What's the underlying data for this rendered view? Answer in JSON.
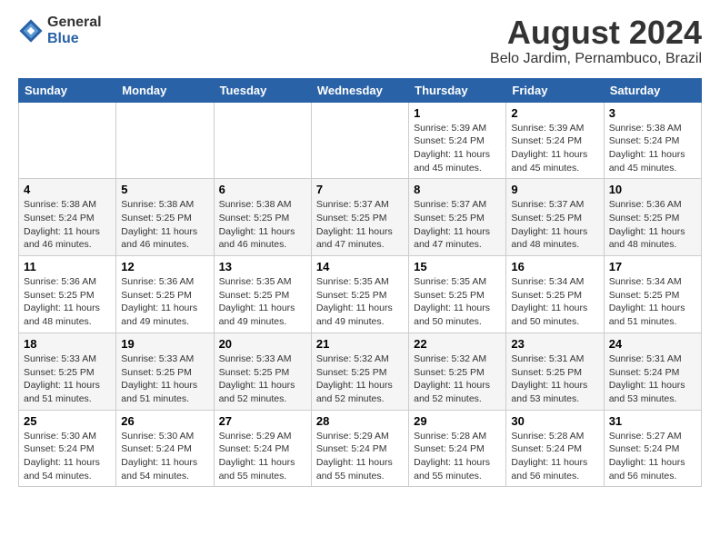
{
  "logo": {
    "line1": "General",
    "line2": "Blue"
  },
  "title": "August 2024",
  "subtitle": "Belo Jardim, Pernambuco, Brazil",
  "days_of_week": [
    "Sunday",
    "Monday",
    "Tuesday",
    "Wednesday",
    "Thursday",
    "Friday",
    "Saturday"
  ],
  "weeks": [
    [
      {
        "day": "",
        "info": ""
      },
      {
        "day": "",
        "info": ""
      },
      {
        "day": "",
        "info": ""
      },
      {
        "day": "",
        "info": ""
      },
      {
        "day": "1",
        "info": "Sunrise: 5:39 AM\nSunset: 5:24 PM\nDaylight: 11 hours\nand 45 minutes."
      },
      {
        "day": "2",
        "info": "Sunrise: 5:39 AM\nSunset: 5:24 PM\nDaylight: 11 hours\nand 45 minutes."
      },
      {
        "day": "3",
        "info": "Sunrise: 5:38 AM\nSunset: 5:24 PM\nDaylight: 11 hours\nand 45 minutes."
      }
    ],
    [
      {
        "day": "4",
        "info": "Sunrise: 5:38 AM\nSunset: 5:24 PM\nDaylight: 11 hours\nand 46 minutes."
      },
      {
        "day": "5",
        "info": "Sunrise: 5:38 AM\nSunset: 5:25 PM\nDaylight: 11 hours\nand 46 minutes."
      },
      {
        "day": "6",
        "info": "Sunrise: 5:38 AM\nSunset: 5:25 PM\nDaylight: 11 hours\nand 46 minutes."
      },
      {
        "day": "7",
        "info": "Sunrise: 5:37 AM\nSunset: 5:25 PM\nDaylight: 11 hours\nand 47 minutes."
      },
      {
        "day": "8",
        "info": "Sunrise: 5:37 AM\nSunset: 5:25 PM\nDaylight: 11 hours\nand 47 minutes."
      },
      {
        "day": "9",
        "info": "Sunrise: 5:37 AM\nSunset: 5:25 PM\nDaylight: 11 hours\nand 48 minutes."
      },
      {
        "day": "10",
        "info": "Sunrise: 5:36 AM\nSunset: 5:25 PM\nDaylight: 11 hours\nand 48 minutes."
      }
    ],
    [
      {
        "day": "11",
        "info": "Sunrise: 5:36 AM\nSunset: 5:25 PM\nDaylight: 11 hours\nand 48 minutes."
      },
      {
        "day": "12",
        "info": "Sunrise: 5:36 AM\nSunset: 5:25 PM\nDaylight: 11 hours\nand 49 minutes."
      },
      {
        "day": "13",
        "info": "Sunrise: 5:35 AM\nSunset: 5:25 PM\nDaylight: 11 hours\nand 49 minutes."
      },
      {
        "day": "14",
        "info": "Sunrise: 5:35 AM\nSunset: 5:25 PM\nDaylight: 11 hours\nand 49 minutes."
      },
      {
        "day": "15",
        "info": "Sunrise: 5:35 AM\nSunset: 5:25 PM\nDaylight: 11 hours\nand 50 minutes."
      },
      {
        "day": "16",
        "info": "Sunrise: 5:34 AM\nSunset: 5:25 PM\nDaylight: 11 hours\nand 50 minutes."
      },
      {
        "day": "17",
        "info": "Sunrise: 5:34 AM\nSunset: 5:25 PM\nDaylight: 11 hours\nand 51 minutes."
      }
    ],
    [
      {
        "day": "18",
        "info": "Sunrise: 5:33 AM\nSunset: 5:25 PM\nDaylight: 11 hours\nand 51 minutes."
      },
      {
        "day": "19",
        "info": "Sunrise: 5:33 AM\nSunset: 5:25 PM\nDaylight: 11 hours\nand 51 minutes."
      },
      {
        "day": "20",
        "info": "Sunrise: 5:33 AM\nSunset: 5:25 PM\nDaylight: 11 hours\nand 52 minutes."
      },
      {
        "day": "21",
        "info": "Sunrise: 5:32 AM\nSunset: 5:25 PM\nDaylight: 11 hours\nand 52 minutes."
      },
      {
        "day": "22",
        "info": "Sunrise: 5:32 AM\nSunset: 5:25 PM\nDaylight: 11 hours\nand 52 minutes."
      },
      {
        "day": "23",
        "info": "Sunrise: 5:31 AM\nSunset: 5:25 PM\nDaylight: 11 hours\nand 53 minutes."
      },
      {
        "day": "24",
        "info": "Sunrise: 5:31 AM\nSunset: 5:24 PM\nDaylight: 11 hours\nand 53 minutes."
      }
    ],
    [
      {
        "day": "25",
        "info": "Sunrise: 5:30 AM\nSunset: 5:24 PM\nDaylight: 11 hours\nand 54 minutes."
      },
      {
        "day": "26",
        "info": "Sunrise: 5:30 AM\nSunset: 5:24 PM\nDaylight: 11 hours\nand 54 minutes."
      },
      {
        "day": "27",
        "info": "Sunrise: 5:29 AM\nSunset: 5:24 PM\nDaylight: 11 hours\nand 55 minutes."
      },
      {
        "day": "28",
        "info": "Sunrise: 5:29 AM\nSunset: 5:24 PM\nDaylight: 11 hours\nand 55 minutes."
      },
      {
        "day": "29",
        "info": "Sunrise: 5:28 AM\nSunset: 5:24 PM\nDaylight: 11 hours\nand 55 minutes."
      },
      {
        "day": "30",
        "info": "Sunrise: 5:28 AM\nSunset: 5:24 PM\nDaylight: 11 hours\nand 56 minutes."
      },
      {
        "day": "31",
        "info": "Sunrise: 5:27 AM\nSunset: 5:24 PM\nDaylight: 11 hours\nand 56 minutes."
      }
    ]
  ]
}
